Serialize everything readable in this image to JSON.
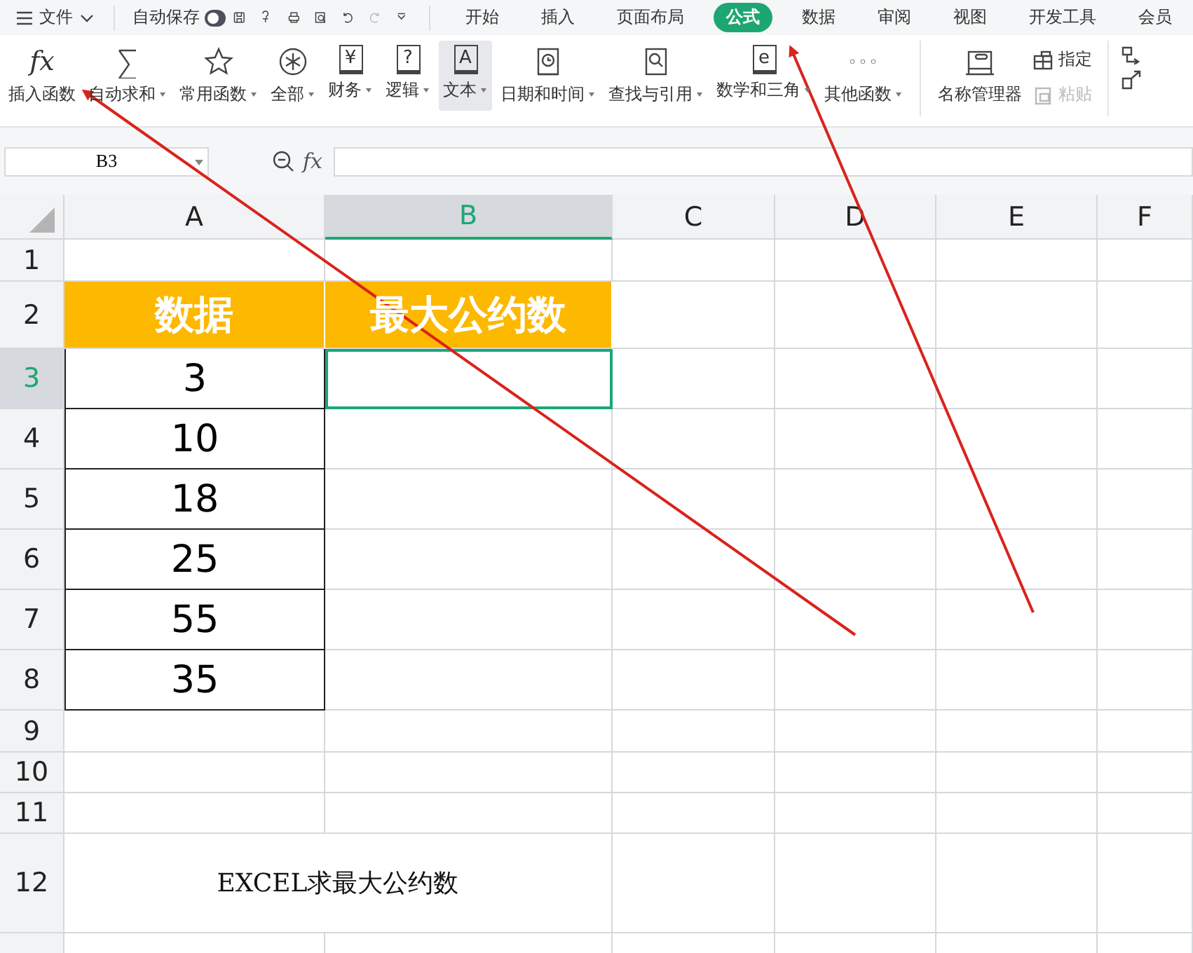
{
  "menu": {
    "label": "文件"
  },
  "autosave": {
    "label": "自动保存",
    "on": false
  },
  "tabs": [
    {
      "label": "开始",
      "selected": false
    },
    {
      "label": "插入",
      "selected": false
    },
    {
      "label": "页面布局",
      "selected": false
    },
    {
      "label": "公式",
      "selected": true
    },
    {
      "label": "数据",
      "selected": false
    },
    {
      "label": "审阅",
      "selected": false
    },
    {
      "label": "视图",
      "selected": false
    },
    {
      "label": "开发工具",
      "selected": false
    },
    {
      "label": "会员",
      "selected": false
    }
  ],
  "ribbon": [
    {
      "label": "插入函数",
      "glyph": "fx",
      "dropdown": false,
      "selected": false
    },
    {
      "label": "自动求和",
      "dropdown": true,
      "selected": false
    },
    {
      "label": "常用函数",
      "dropdown": true,
      "selected": false
    },
    {
      "label": "全部",
      "dropdown": true,
      "selected": false
    },
    {
      "label": "财务",
      "glyph": "¥",
      "dropdown": true,
      "selected": false
    },
    {
      "label": "逻辑",
      "glyph": "?",
      "dropdown": true,
      "selected": false
    },
    {
      "label": "文本",
      "glyph": "A",
      "dropdown": true,
      "selected": true
    },
    {
      "label": "日期和时间",
      "dropdown": true,
      "selected": false
    },
    {
      "label": "查找与引用",
      "dropdown": true,
      "selected": false
    },
    {
      "label": "数学和三角",
      "glyph": "e",
      "dropdown": true,
      "selected": false
    },
    {
      "label": "其他函数",
      "glyph": "◦◦◦",
      "dropdown": true,
      "selected": false
    },
    {
      "label": "名称管理器",
      "dropdown": false,
      "selected": false
    }
  ],
  "ribbon_small": [
    {
      "label": "指定",
      "disabled": false
    },
    {
      "label": "粘贴",
      "disabled": true
    }
  ],
  "formula_bar": {
    "name_box": "B3",
    "fx_label": "fx"
  },
  "columns": [
    {
      "label": "A",
      "selected": false
    },
    {
      "label": "B",
      "selected": true
    },
    {
      "label": "C",
      "selected": false
    },
    {
      "label": "D",
      "selected": false
    },
    {
      "label": "E",
      "selected": false
    },
    {
      "label": "F",
      "selected": false
    }
  ],
  "rows": [
    {
      "header": "1",
      "selected": false,
      "cells": []
    },
    {
      "header": "2",
      "selected": false,
      "cells": [
        {
          "kind": "title",
          "text": "数据"
        },
        {
          "kind": "title",
          "text": "最大公约数"
        }
      ]
    },
    {
      "header": "3",
      "selected": true,
      "cells": [
        {
          "kind": "value",
          "text": "3"
        },
        {
          "kind": "active"
        }
      ]
    },
    {
      "header": "4",
      "selected": false,
      "cells": [
        {
          "kind": "value",
          "text": "10"
        }
      ]
    },
    {
      "header": "5",
      "selected": false,
      "cells": [
        {
          "kind": "value",
          "text": "18"
        }
      ]
    },
    {
      "header": "6",
      "selected": false,
      "cells": [
        {
          "kind": "value",
          "text": "25"
        }
      ]
    },
    {
      "header": "7",
      "selected": false,
      "cells": [
        {
          "kind": "value",
          "text": "55"
        }
      ]
    },
    {
      "header": "8",
      "selected": false,
      "cells": [
        {
          "kind": "value",
          "text": "35"
        }
      ]
    },
    {
      "header": "9",
      "selected": false,
      "cells": []
    },
    {
      "header": "10",
      "selected": false,
      "cells": []
    },
    {
      "header": "11",
      "selected": false,
      "cells": []
    },
    {
      "header": "12",
      "selected": false,
      "cells": [
        {
          "kind": "note",
          "text": "EXCEL求最大公约数"
        }
      ]
    }
  ]
}
